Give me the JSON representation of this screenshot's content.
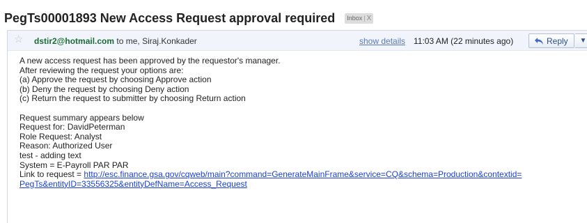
{
  "subject": "PegTs00001893 New Access Request approval required",
  "label": {
    "name": "Inbox",
    "remove": "X"
  },
  "header": {
    "sender_email": "dstir2@hotmail.com",
    "recipients": "to me, Siraj.Konkader",
    "show_details": "show details",
    "time": "11:03 AM (22 minutes ago)",
    "reply_label": "Reply",
    "more_glyph": "▼"
  },
  "body": {
    "paragraph1": [
      "A new access request has been approved by the requestor's manager.",
      "After reviewing the request your options are:",
      "(a) Approve the request by choosing Approve action",
      "(b) Deny the request by choosing Deny action",
      "(c) Return the request to submitter by choosing Return action"
    ],
    "paragraph2": [
      "Request summary appears below",
      "Request for: DavidPeterman",
      "Role Request: Analyst",
      "Reason: Authorized User",
      "test - adding text",
      "System = E-Payroll PAR PAR"
    ],
    "link_prefix": "Link to request = ",
    "link_line1": "http://esc.finance.gsa.gov/cqweb/main?command=GenerateMainFrame&service=CQ&schema=Production&contextid=",
    "link_line2": "PegTs&entityID=33556325&entityDefName=Access_Request"
  },
  "icons": {
    "star": "star-icon",
    "reply": "reply-arrow-icon",
    "more": "chevron-down-icon"
  },
  "colors": {
    "sender": "#1a6b36",
    "link": "#1a3fd4",
    "header_bg": "#f1f5fb"
  }
}
